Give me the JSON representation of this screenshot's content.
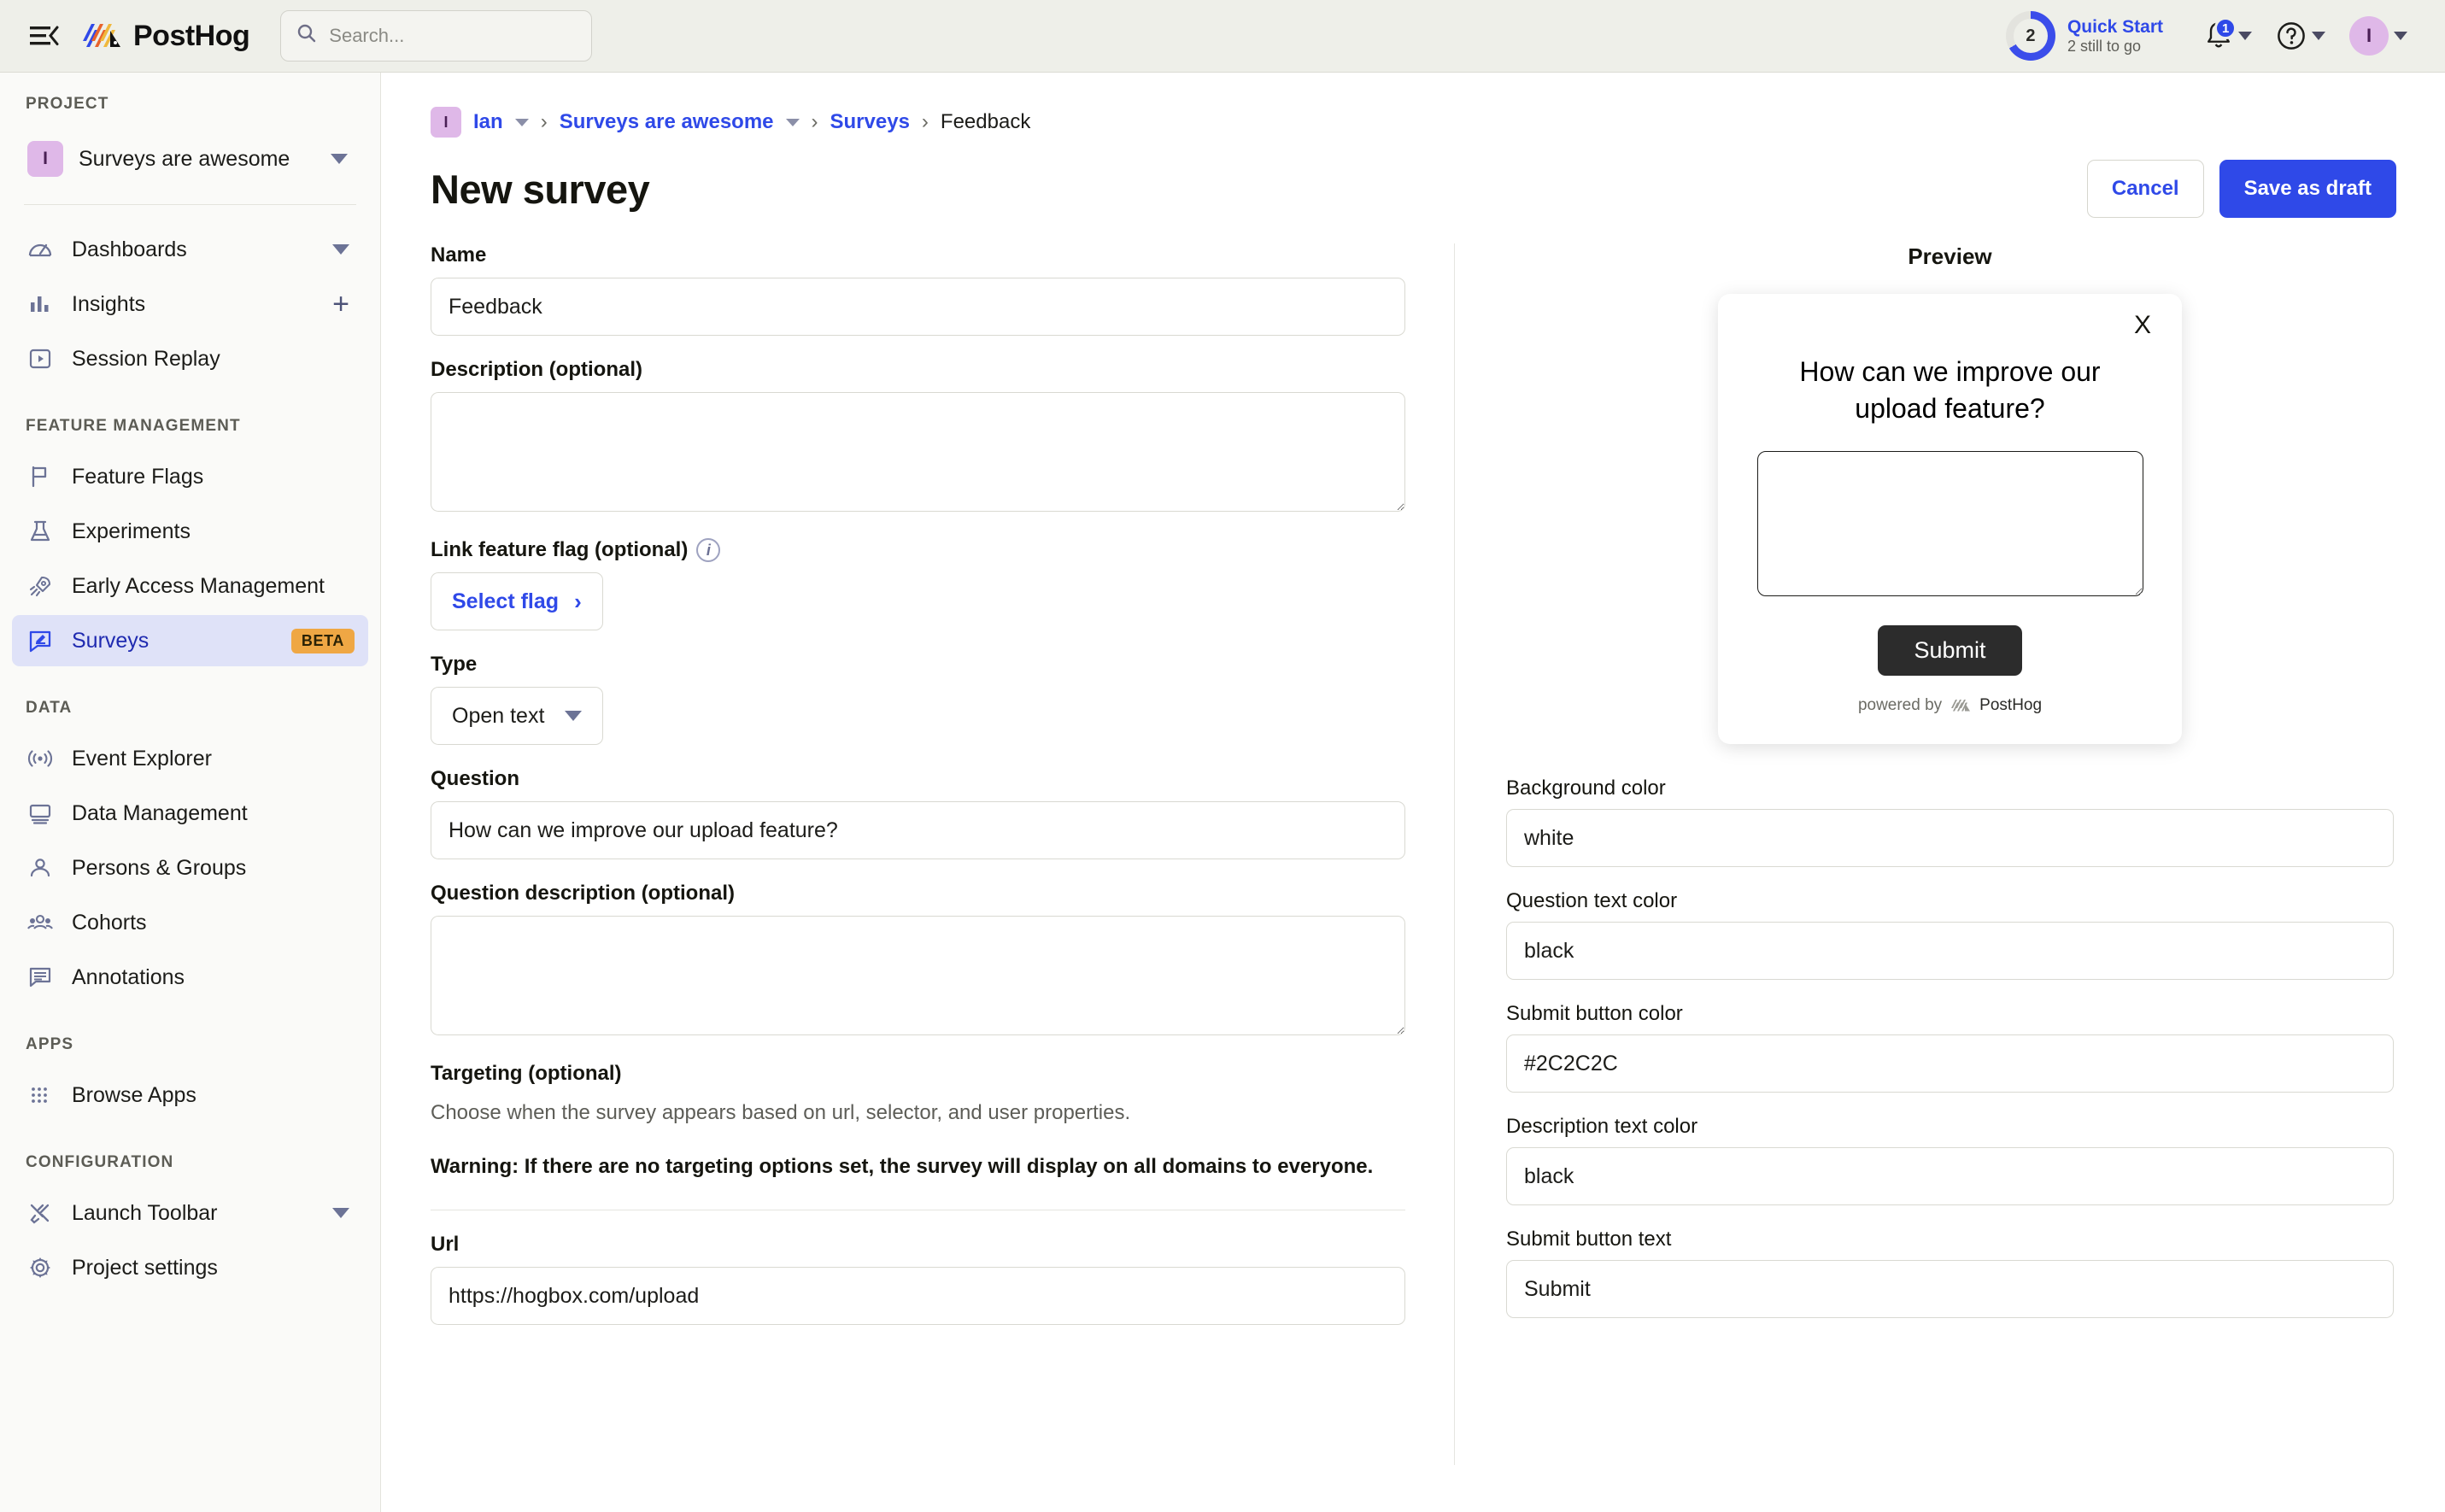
{
  "topbar": {
    "menu_icon": "hamburger-collapse-icon",
    "brand": "PostHog",
    "search_placeholder": "Search...",
    "search_icon": "search-icon",
    "quickstart": {
      "count": "2",
      "title": "Quick Start",
      "subtitle": "2 still to go"
    },
    "notifications": {
      "icon": "bell-icon",
      "badge": "1"
    },
    "help": {
      "icon": "question-circle-icon"
    },
    "account": {
      "initial": "I"
    }
  },
  "sidebar": {
    "sections": [
      {
        "label": "PROJECT",
        "project": {
          "initial": "I",
          "name": "Surveys are awesome"
        },
        "items": [
          {
            "label": "Dashboards",
            "icon": "gauge-icon",
            "trailing": "caret",
            "active": false
          },
          {
            "label": "Insights",
            "icon": "bar-chart-icon",
            "trailing": "plus",
            "active": false
          },
          {
            "label": "Session Replay",
            "icon": "play-square-icon",
            "trailing": "",
            "active": false
          }
        ]
      },
      {
        "label": "FEATURE MANAGEMENT",
        "items": [
          {
            "label": "Feature Flags",
            "icon": "flag-icon",
            "trailing": "",
            "active": false
          },
          {
            "label": "Experiments",
            "icon": "flask-icon",
            "trailing": "",
            "active": false
          },
          {
            "label": "Early Access Management",
            "icon": "rocket-icon",
            "trailing": "",
            "active": false
          },
          {
            "label": "Surveys",
            "icon": "survey-icon",
            "trailing": "beta",
            "badge": "BETA",
            "active": true
          }
        ]
      },
      {
        "label": "DATA",
        "items": [
          {
            "label": "Event Explorer",
            "icon": "broadcast-icon",
            "trailing": "",
            "active": false
          },
          {
            "label": "Data Management",
            "icon": "monitor-icon",
            "trailing": "",
            "active": false
          },
          {
            "label": "Persons & Groups",
            "icon": "person-icon",
            "trailing": "",
            "active": false
          },
          {
            "label": "Cohorts",
            "icon": "people-group-icon",
            "trailing": "",
            "active": false
          },
          {
            "label": "Annotations",
            "icon": "comment-lines-icon",
            "trailing": "",
            "active": false
          }
        ]
      },
      {
        "label": "APPS",
        "items": [
          {
            "label": "Browse Apps",
            "icon": "grid-dots-icon",
            "trailing": "",
            "active": false
          }
        ]
      },
      {
        "label": "CONFIGURATION",
        "items": [
          {
            "label": "Launch Toolbar",
            "icon": "tools-icon",
            "trailing": "caret",
            "active": false
          },
          {
            "label": "Project settings",
            "icon": "gear-icon",
            "trailing": "",
            "active": false
          }
        ]
      }
    ]
  },
  "breadcrumb": {
    "org_initial": "I",
    "org": "Ian",
    "project": "Surveys are awesome",
    "section": "Surveys",
    "current": "Feedback",
    "separator": "›"
  },
  "page": {
    "title": "New survey",
    "cancel_label": "Cancel",
    "save_label": "Save as draft"
  },
  "form": {
    "name_label": "Name",
    "name_value": "Feedback",
    "description_label": "Description (optional)",
    "description_value": "",
    "link_flag_label": "Link feature flag (optional)",
    "select_flag_label": "Select flag",
    "select_flag_chevron": "›",
    "type_label": "Type",
    "type_value": "Open text",
    "question_label": "Question",
    "question_value": "How can we improve our upload feature?",
    "question_description_label": "Question description (optional)",
    "question_description_value": "",
    "targeting_label": "Targeting (optional)",
    "targeting_help": "Choose when the survey appears based on url, selector, and user properties.",
    "targeting_warning": "Warning: If there are no targeting options set, the survey will display on all domains to everyone.",
    "url_label": "Url",
    "url_value": "https://hogbox.com/upload"
  },
  "preview": {
    "title": "Preview",
    "close_label": "X",
    "question": "How can we improve our upload feature?",
    "answer_value": "",
    "submit_label": "Submit",
    "powered_prefix": "powered by",
    "powered_brand": "PostHog"
  },
  "appearance": {
    "background_color_label": "Background color",
    "background_color_value": "white",
    "question_text_color_label": "Question text color",
    "question_text_color_value": "black",
    "submit_button_color_label": "Submit button color",
    "submit_button_color_value": "#2C2C2C",
    "description_text_color_label": "Description text color",
    "description_text_color_value": "black",
    "submit_button_text_label": "Submit button text",
    "submit_button_text_value": "Submit"
  },
  "colors": {
    "accent": "#2f49e8",
    "beta_badge": "#efa744",
    "avatar": "#dfb8e8",
    "submit_button": "#2C2C2C"
  }
}
